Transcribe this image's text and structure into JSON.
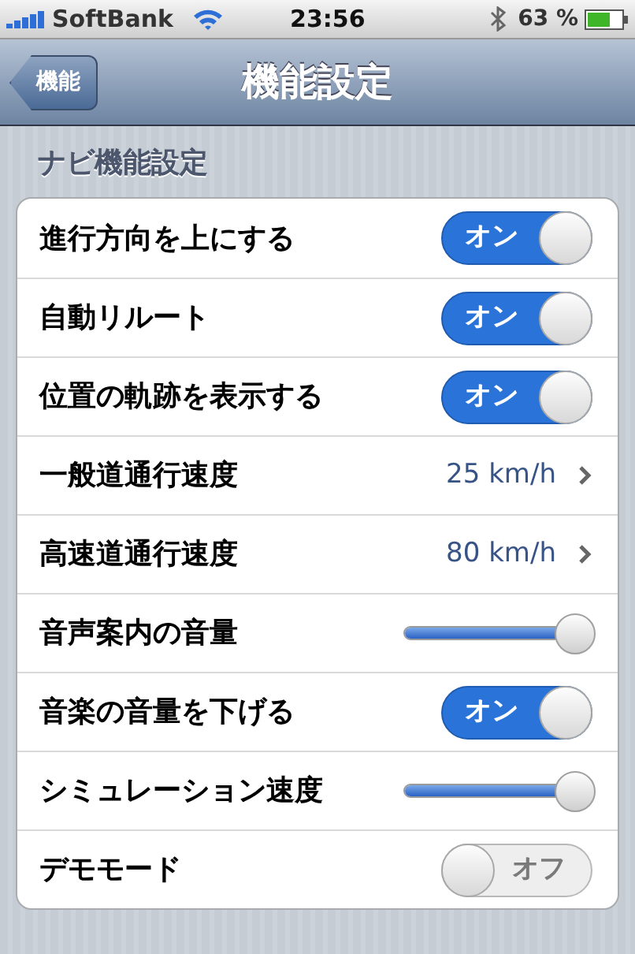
{
  "status_bar": {
    "carrier": "SoftBank",
    "time": "23:56",
    "battery": "63 %"
  },
  "nav_bar": {
    "back": "機能",
    "title": "機能設定"
  },
  "section": {
    "title": "ナビ機能設定",
    "rows": [
      {
        "kind": "switch",
        "label": "進行方向を上にする",
        "on": true,
        "text": "オン"
      },
      {
        "kind": "switch",
        "label": "自動リルート",
        "on": true,
        "text": "オン"
      },
      {
        "kind": "switch",
        "label": "位置の軌跡を表示する",
        "on": true,
        "text": "オン"
      },
      {
        "kind": "value",
        "label": "一般道通行速度",
        "value": "25 km/h"
      },
      {
        "kind": "value",
        "label": "高速道通行速度",
        "value": "80 km/h"
      },
      {
        "kind": "slider",
        "label": "音声案内の音量",
        "level": 1
      },
      {
        "kind": "switch",
        "label": "音楽の音量を下げる",
        "on": true,
        "text": "オン"
      },
      {
        "kind": "slider",
        "label": "シミュレーション速度",
        "level": 1
      },
      {
        "kind": "switch",
        "label": "デモモード",
        "on": false,
        "text": "オフ"
      }
    ]
  }
}
